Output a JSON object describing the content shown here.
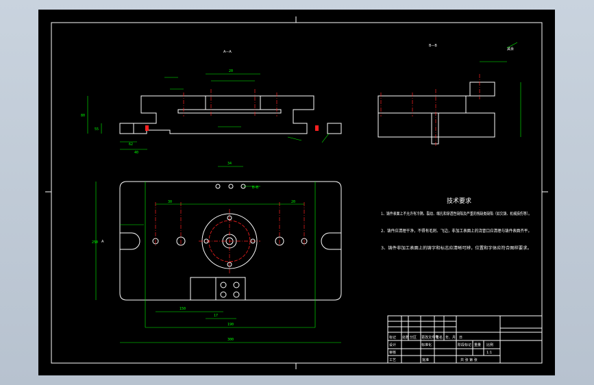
{
  "views": {
    "front_section_label": "A—A",
    "side_section_label": "B—B",
    "rest_roughness": "其余",
    "plan_section_a": "A",
    "plan_section_b": "B—B",
    "dimension_labels": [
      "80",
      "55",
      "62",
      "40",
      "45",
      "20",
      "250",
      "200",
      "30",
      "20",
      "150",
      "190",
      "300",
      "17",
      "34"
    ]
  },
  "tech_requirements": {
    "heading": "技术要求",
    "items": [
      "1、铸件表面上不允许有冷隔、裂纹、缩孔和穿透性缺陷及严重的残缺类缺陷（如欠铸、机械损伤等）。",
      "2、铸件应清理干净，不得有毛刺、飞边，非加工表面上的浇冒口应清理与铸件表面齐平。",
      "3、铸件非加工表面上的铸字和标志应清晰可辨，位置和字体应符合图样要求。"
    ]
  },
  "title_block": {
    "row_labels": [
      "标记",
      "处数",
      "分区",
      "更改文件号",
      "签名",
      "年、月、日"
    ],
    "design": "设计",
    "standardize": "标准化",
    "review": "审核",
    "process": "工艺",
    "approve": "批准",
    "stage_marks": "阶段标记",
    "weight": "重量",
    "scale": "比例",
    "scale_value": "1:1",
    "sheets": "共  张  第  张"
  }
}
